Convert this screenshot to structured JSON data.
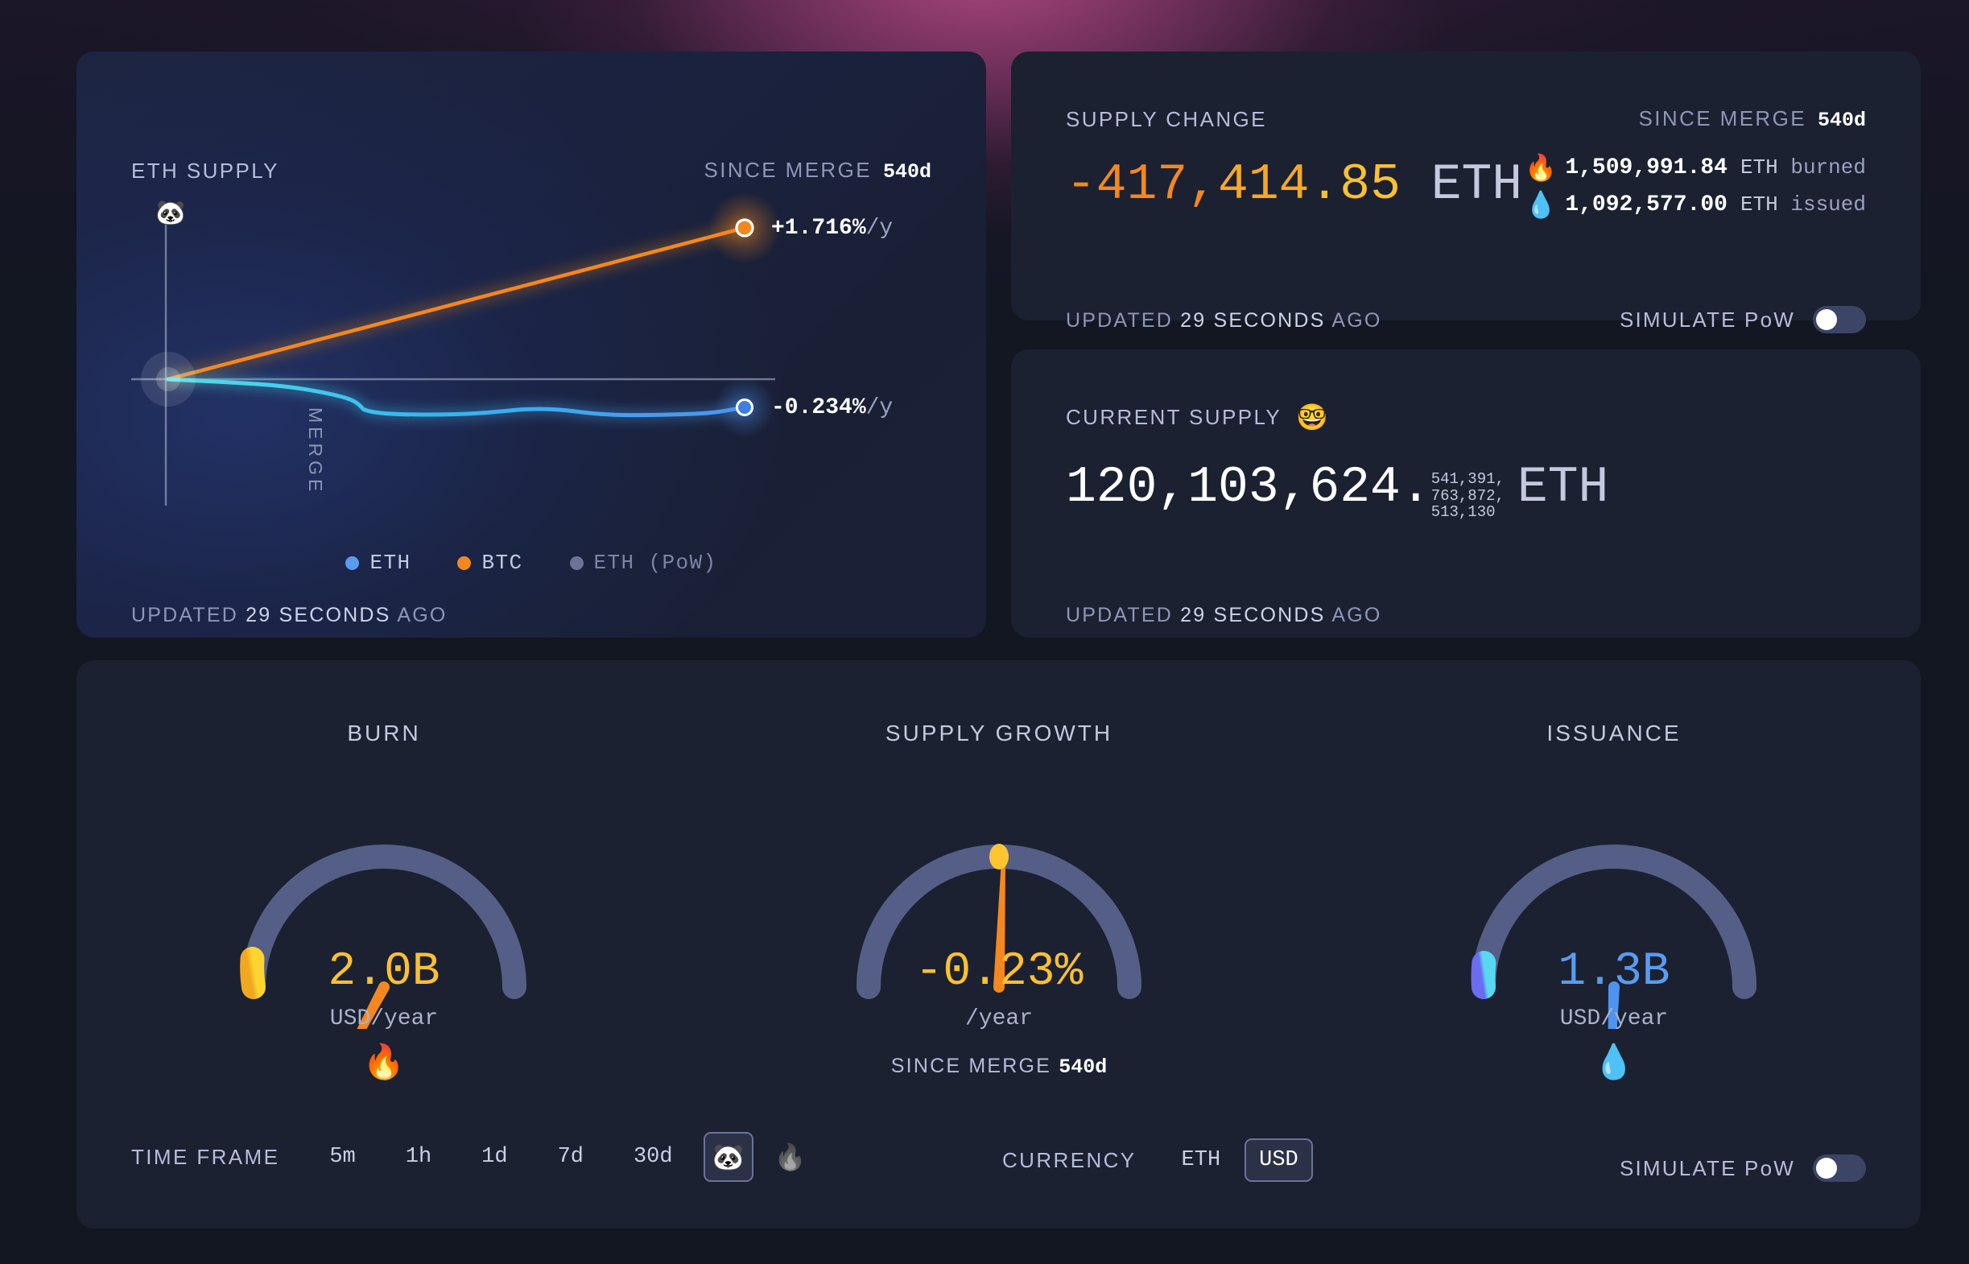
{
  "supply_card": {
    "title": "ETH SUPPLY",
    "since_merge_label": "SINCE MERGE",
    "since_merge_value": "540d",
    "merge_axis_label": "MERGE",
    "merge_icon": "panda-face",
    "updated_prefix": "UPDATED",
    "updated_value": "29 SECONDS",
    "updated_suffix": "AGO",
    "eth_point_label": "-0.234%",
    "eth_point_unit": "/y",
    "btc_point_label": "+1.716%",
    "btc_point_unit": "/y",
    "legend": [
      {
        "label": "ETH",
        "color": "#5a9bf0"
      },
      {
        "label": "BTC",
        "color": "#f5871f"
      },
      {
        "label": "ETH (PoW)",
        "color": "#6b7496"
      }
    ]
  },
  "supply_change_card": {
    "title": "SUPPLY CHANGE",
    "since_merge_label": "SINCE MERGE",
    "since_merge_value": "540d",
    "value_part1": "-417,",
    "value_part2": "414",
    "value_part3": ".85",
    "value_unit": "ETH",
    "burned_icon": "fire",
    "burned_amount": "1,509,991.84",
    "burned_asset": "ETH",
    "burned_word": "burned",
    "issued_icon": "droplet",
    "issued_amount": "1,092,577.00",
    "issued_asset": "ETH",
    "issued_word": "issued",
    "updated_prefix": "UPDATED",
    "updated_value": "29 SECONDS",
    "updated_suffix": "AGO",
    "simulate_pow_label": "SIMULATE PoW",
    "simulate_pow_on": false
  },
  "current_supply_card": {
    "title": "CURRENT SUPPLY",
    "title_icon": "nerd-face",
    "integer_part": "120,103,624.",
    "fraction_part": "541,391,\n763,872,\n513,130",
    "unit": "ETH",
    "updated_prefix": "UPDATED",
    "updated_value": "29 SECONDS",
    "updated_suffix": "AGO"
  },
  "gauges": [
    {
      "title": "BURN",
      "value": "2.0B",
      "unit": "USD/year",
      "value_color": "#fdc02f",
      "icon": "fire",
      "arc_fraction": 0.055,
      "needle_deg": -62,
      "arc_color_from": "#fdc530",
      "arc_color_to": "#f5a41f",
      "needle_color": "#f5871f"
    },
    {
      "title": "SUPPLY GROWTH",
      "value": "-0.23%",
      "unit": "/year",
      "value_color": "#fdc02f",
      "sub_label": "SINCE MERGE",
      "sub_value": "540d",
      "arc_fraction": 0.0,
      "needle_deg": 2,
      "marker_deg": 0,
      "arc_color_from": "#fdc530",
      "arc_color_to": "#fdc530",
      "needle_color": "#f5871f"
    },
    {
      "title": "ISSUANCE",
      "value": "1.3B",
      "unit": "USD/year",
      "value_color": "#5a9bf0",
      "icon": "droplet",
      "arc_fraction": 0.048,
      "needle_deg": -88,
      "arc_color_from": "#57d2f0",
      "arc_color_to": "#6a6df0",
      "needle_color": "#4d93f0"
    }
  ],
  "controls": {
    "timeframe_label": "TIME FRAME",
    "timeframe_options": [
      "5m",
      "1h",
      "1d",
      "7d",
      "30d"
    ],
    "timeframe_selected_icon": "panda-face",
    "timeframe_extra_icon": "fire",
    "currency_label": "CURRENCY",
    "currency_options": [
      "ETH",
      "USD"
    ],
    "currency_selected": "USD",
    "simulate_pow_label": "SIMULATE PoW",
    "simulate_pow_on": false
  },
  "chart_data": {
    "type": "line",
    "title": "ETH SUPPLY",
    "xlabel": "",
    "ylabel": "",
    "annotations": [
      "MERGE"
    ],
    "legend": [
      "ETH",
      "BTC",
      "ETH (PoW)"
    ],
    "series": [
      {
        "name": "BTC",
        "color": "#f5871f",
        "end_label": "+1.716%/y",
        "x": [
          0,
          0.25,
          0.5,
          0.75,
          1
        ],
        "y": [
          0,
          0.429,
          0.858,
          1.287,
          1.716
        ]
      },
      {
        "name": "ETH",
        "color": "#4d93f0",
        "end_label": "-0.234%/y",
        "x": [
          0,
          0.05,
          0.12,
          0.2,
          0.28,
          0.34,
          0.38,
          0.45,
          0.52,
          0.6,
          0.68,
          0.74,
          0.8,
          0.86,
          0.92,
          1
        ],
        "y": [
          0,
          -0.005,
          -0.015,
          -0.03,
          -0.055,
          -0.075,
          -0.145,
          -0.165,
          -0.17,
          -0.172,
          -0.155,
          -0.15,
          -0.175,
          -0.19,
          -0.21,
          -0.234
        ]
      }
    ],
    "ylim": [
      -0.6,
      2.0
    ],
    "xlim": [
      0,
      1
    ],
    "grid": false
  }
}
